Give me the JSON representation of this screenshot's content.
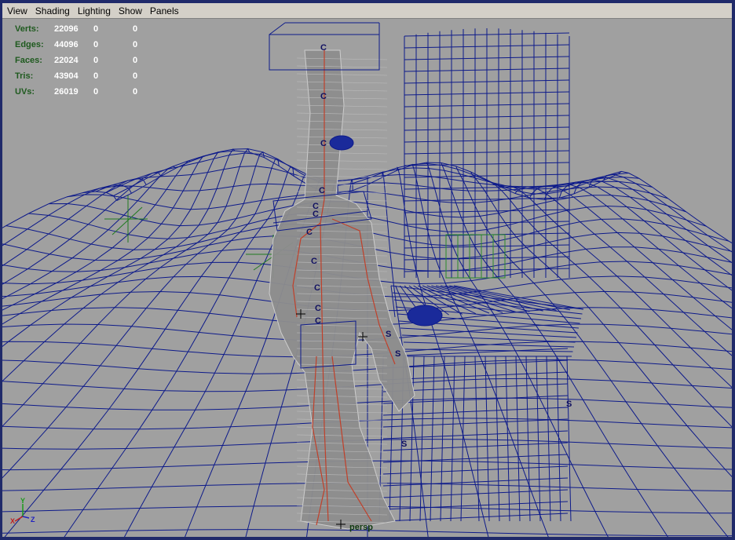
{
  "menu": [
    "View",
    "Shading",
    "Lighting",
    "Show",
    "Panels"
  ],
  "hud": [
    {
      "label": "Verts:",
      "values": [
        "22096",
        "0",
        "0"
      ]
    },
    {
      "label": "Edges:",
      "values": [
        "44096",
        "0",
        "0"
      ]
    },
    {
      "label": "Faces:",
      "values": [
        "22024",
        "0",
        "0"
      ]
    },
    {
      "label": "Tris:",
      "values": [
        "43904",
        "0",
        "0"
      ]
    },
    {
      "label": "UVs:",
      "values": [
        "26019",
        "0",
        "0"
      ]
    }
  ],
  "camera_label": "persp",
  "axis": {
    "x": "X",
    "y": "Y",
    "z": "Z"
  },
  "joint_markers": [
    "C",
    "S"
  ],
  "colors": {
    "viewport_bg": "#a0a0a0",
    "wireframe": "#0d1a8a",
    "bones": "#c0402a",
    "hud_label": "#1f5a1f",
    "frame": "#202a6a"
  }
}
